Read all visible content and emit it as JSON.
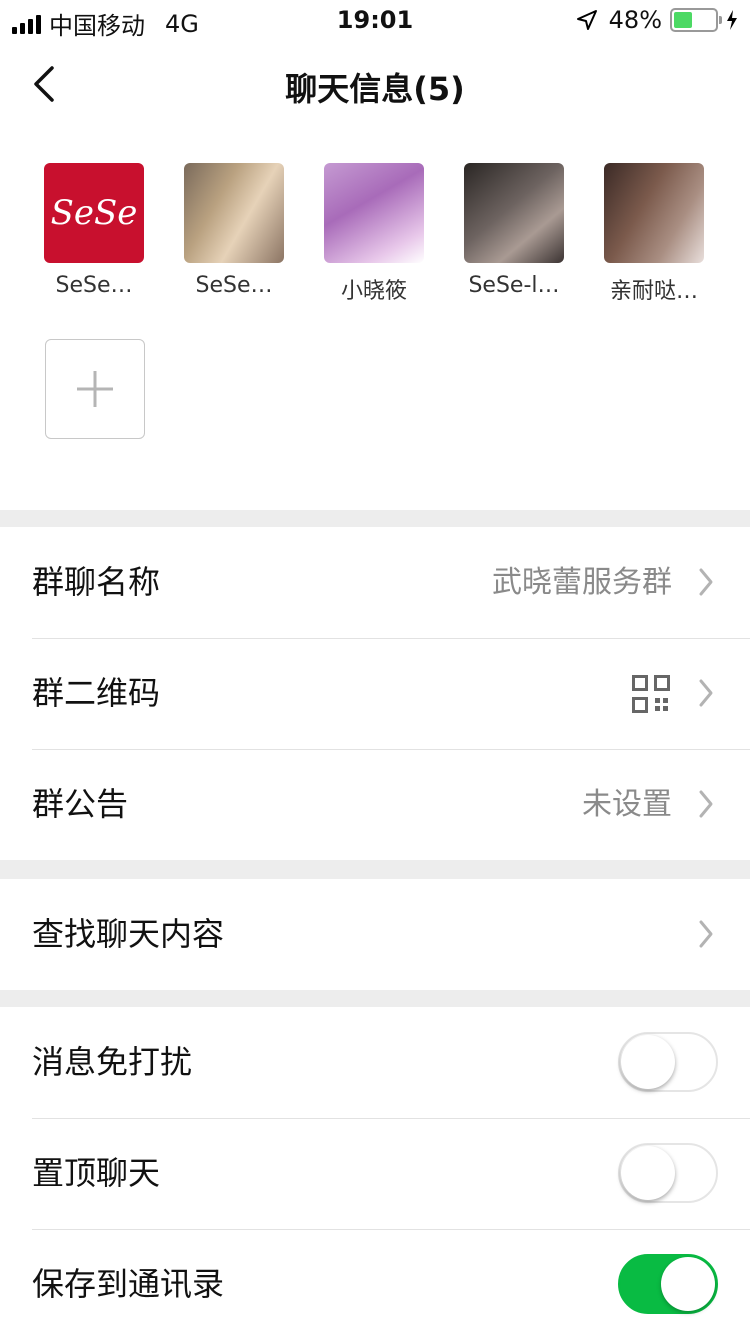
{
  "status_bar": {
    "carrier": "中国移动",
    "network": "4G",
    "time": "19:01",
    "battery": "48%",
    "battery_level": 0.48,
    "battery_color": "#4cd964"
  },
  "header": {
    "title": "聊天信息(5)",
    "back_icon": "chevron-left-icon"
  },
  "members": [
    {
      "name": "SeSe…",
      "avatar_text": "SeSe"
    },
    {
      "name": "SeSe…"
    },
    {
      "name": "小晓筱"
    },
    {
      "name": "SeSe-l…"
    },
    {
      "name": "亲耐哒…"
    }
  ],
  "add_member_icon": "plus-icon",
  "section_info": {
    "group_name": {
      "label": "群聊名称",
      "value": "武晓蕾服务群"
    },
    "qr_code": {
      "label": "群二维码",
      "icon": "qr-code-icon"
    },
    "announcement": {
      "label": "群公告",
      "value": "未设置"
    }
  },
  "section_search": {
    "search_history": {
      "label": "查找聊天内容"
    }
  },
  "section_settings": {
    "mute": {
      "label": "消息免打扰",
      "on": false
    },
    "sticky": {
      "label": "置顶聊天",
      "on": false
    },
    "save_contacts": {
      "label": "保存到通讯录",
      "on": true
    }
  },
  "colors": {
    "accent_green": "#09bb43",
    "logo_red": "#c8102e"
  }
}
